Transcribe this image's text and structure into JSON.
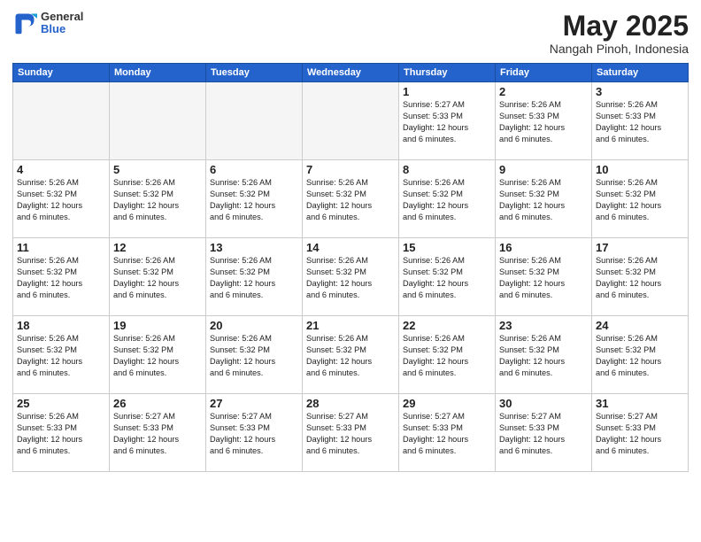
{
  "header": {
    "logo": {
      "general": "General",
      "blue": "Blue"
    },
    "title": "May 2025",
    "location": "Nangah Pinoh, Indonesia"
  },
  "weekdays": [
    "Sunday",
    "Monday",
    "Tuesday",
    "Wednesday",
    "Thursday",
    "Friday",
    "Saturday"
  ],
  "weeks": [
    [
      {
        "day": "",
        "info": ""
      },
      {
        "day": "",
        "info": ""
      },
      {
        "day": "",
        "info": ""
      },
      {
        "day": "",
        "info": ""
      },
      {
        "day": "1",
        "info": "Sunrise: 5:27 AM\nSunset: 5:33 PM\nDaylight: 12 hours\nand 6 minutes."
      },
      {
        "day": "2",
        "info": "Sunrise: 5:26 AM\nSunset: 5:33 PM\nDaylight: 12 hours\nand 6 minutes."
      },
      {
        "day": "3",
        "info": "Sunrise: 5:26 AM\nSunset: 5:33 PM\nDaylight: 12 hours\nand 6 minutes."
      }
    ],
    [
      {
        "day": "4",
        "info": "Sunrise: 5:26 AM\nSunset: 5:32 PM\nDaylight: 12 hours\nand 6 minutes."
      },
      {
        "day": "5",
        "info": "Sunrise: 5:26 AM\nSunset: 5:32 PM\nDaylight: 12 hours\nand 6 minutes."
      },
      {
        "day": "6",
        "info": "Sunrise: 5:26 AM\nSunset: 5:32 PM\nDaylight: 12 hours\nand 6 minutes."
      },
      {
        "day": "7",
        "info": "Sunrise: 5:26 AM\nSunset: 5:32 PM\nDaylight: 12 hours\nand 6 minutes."
      },
      {
        "day": "8",
        "info": "Sunrise: 5:26 AM\nSunset: 5:32 PM\nDaylight: 12 hours\nand 6 minutes."
      },
      {
        "day": "9",
        "info": "Sunrise: 5:26 AM\nSunset: 5:32 PM\nDaylight: 12 hours\nand 6 minutes."
      },
      {
        "day": "10",
        "info": "Sunrise: 5:26 AM\nSunset: 5:32 PM\nDaylight: 12 hours\nand 6 minutes."
      }
    ],
    [
      {
        "day": "11",
        "info": "Sunrise: 5:26 AM\nSunset: 5:32 PM\nDaylight: 12 hours\nand 6 minutes."
      },
      {
        "day": "12",
        "info": "Sunrise: 5:26 AM\nSunset: 5:32 PM\nDaylight: 12 hours\nand 6 minutes."
      },
      {
        "day": "13",
        "info": "Sunrise: 5:26 AM\nSunset: 5:32 PM\nDaylight: 12 hours\nand 6 minutes."
      },
      {
        "day": "14",
        "info": "Sunrise: 5:26 AM\nSunset: 5:32 PM\nDaylight: 12 hours\nand 6 minutes."
      },
      {
        "day": "15",
        "info": "Sunrise: 5:26 AM\nSunset: 5:32 PM\nDaylight: 12 hours\nand 6 minutes."
      },
      {
        "day": "16",
        "info": "Sunrise: 5:26 AM\nSunset: 5:32 PM\nDaylight: 12 hours\nand 6 minutes."
      },
      {
        "day": "17",
        "info": "Sunrise: 5:26 AM\nSunset: 5:32 PM\nDaylight: 12 hours\nand 6 minutes."
      }
    ],
    [
      {
        "day": "18",
        "info": "Sunrise: 5:26 AM\nSunset: 5:32 PM\nDaylight: 12 hours\nand 6 minutes."
      },
      {
        "day": "19",
        "info": "Sunrise: 5:26 AM\nSunset: 5:32 PM\nDaylight: 12 hours\nand 6 minutes."
      },
      {
        "day": "20",
        "info": "Sunrise: 5:26 AM\nSunset: 5:32 PM\nDaylight: 12 hours\nand 6 minutes."
      },
      {
        "day": "21",
        "info": "Sunrise: 5:26 AM\nSunset: 5:32 PM\nDaylight: 12 hours\nand 6 minutes."
      },
      {
        "day": "22",
        "info": "Sunrise: 5:26 AM\nSunset: 5:32 PM\nDaylight: 12 hours\nand 6 minutes."
      },
      {
        "day": "23",
        "info": "Sunrise: 5:26 AM\nSunset: 5:32 PM\nDaylight: 12 hours\nand 6 minutes."
      },
      {
        "day": "24",
        "info": "Sunrise: 5:26 AM\nSunset: 5:32 PM\nDaylight: 12 hours\nand 6 minutes."
      }
    ],
    [
      {
        "day": "25",
        "info": "Sunrise: 5:26 AM\nSunset: 5:33 PM\nDaylight: 12 hours\nand 6 minutes."
      },
      {
        "day": "26",
        "info": "Sunrise: 5:27 AM\nSunset: 5:33 PM\nDaylight: 12 hours\nand 6 minutes."
      },
      {
        "day": "27",
        "info": "Sunrise: 5:27 AM\nSunset: 5:33 PM\nDaylight: 12 hours\nand 6 minutes."
      },
      {
        "day": "28",
        "info": "Sunrise: 5:27 AM\nSunset: 5:33 PM\nDaylight: 12 hours\nand 6 minutes."
      },
      {
        "day": "29",
        "info": "Sunrise: 5:27 AM\nSunset: 5:33 PM\nDaylight: 12 hours\nand 6 minutes."
      },
      {
        "day": "30",
        "info": "Sunrise: 5:27 AM\nSunset: 5:33 PM\nDaylight: 12 hours\nand 6 minutes."
      },
      {
        "day": "31",
        "info": "Sunrise: 5:27 AM\nSunset: 5:33 PM\nDaylight: 12 hours\nand 6 minutes."
      }
    ]
  ]
}
